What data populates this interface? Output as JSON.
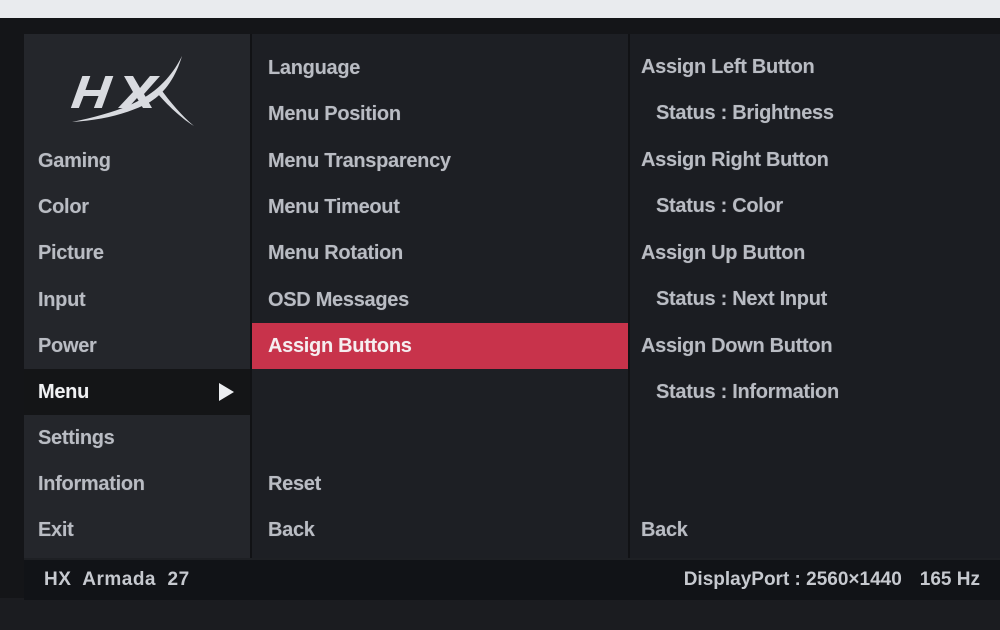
{
  "main_menu": {
    "items": [
      {
        "label": "Gaming"
      },
      {
        "label": "Color"
      },
      {
        "label": "Picture"
      },
      {
        "label": "Input"
      },
      {
        "label": "Power"
      },
      {
        "label": "Menu"
      },
      {
        "label": "Settings"
      },
      {
        "label": "Information"
      },
      {
        "label": "Exit"
      }
    ],
    "selected": "Menu"
  },
  "sub_menu": {
    "items": [
      {
        "label": "Language"
      },
      {
        "label": "Menu Position"
      },
      {
        "label": "Menu Transparency"
      },
      {
        "label": "Menu Timeout"
      },
      {
        "label": "Menu Rotation"
      },
      {
        "label": "OSD Messages"
      },
      {
        "label": "Assign Buttons"
      }
    ],
    "selected": "Assign Buttons",
    "reset_label": "Reset",
    "back_label": "Back"
  },
  "detail": {
    "items": [
      {
        "label": "Assign Left Button"
      },
      {
        "label": "Status : Brightness"
      },
      {
        "label": "Assign Right Button"
      },
      {
        "label": "Status : Color"
      },
      {
        "label": "Assign Up Button"
      },
      {
        "label": "Status : Next Input"
      },
      {
        "label": "Assign Down Button"
      },
      {
        "label": "Status : Information"
      }
    ],
    "back_label": "Back"
  },
  "footer": {
    "model": "HX  Armada  27",
    "input": "DisplayPort : 2560×1440",
    "refresh": "165 Hz"
  },
  "logo": {
    "icon": "hyperx-logo-icon"
  },
  "colors": {
    "accent": "#c8334b",
    "selected_bg": "#141517",
    "text": "#b9bcc3"
  }
}
